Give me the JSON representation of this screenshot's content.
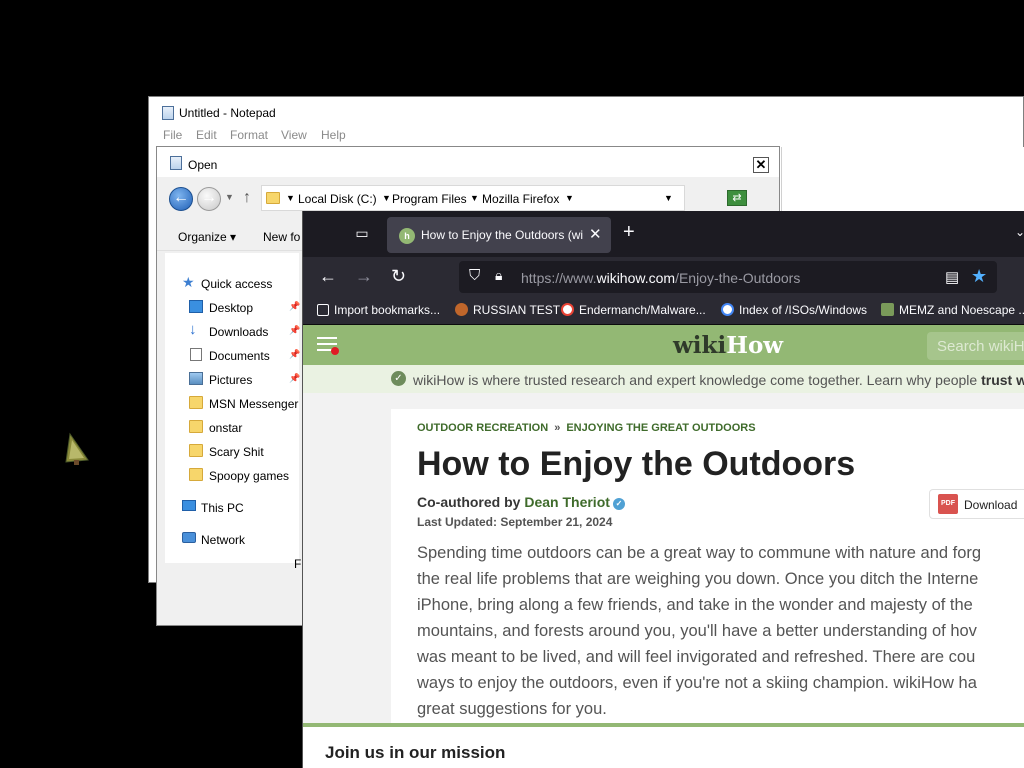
{
  "notepad": {
    "title": "Untitled - Notepad",
    "menu": [
      "File",
      "Edit",
      "Format",
      "View",
      "Help"
    ]
  },
  "open_dialog": {
    "title": "Open",
    "breadcrumb": [
      "Local Disk (C:)",
      "Program Files",
      "Mozilla Firefox"
    ],
    "toolbar": {
      "organize": "Organize",
      "new_folder": "New fo"
    },
    "nav_items": [
      {
        "label": "Quick access",
        "icon": "star-icon"
      },
      {
        "label": "Desktop",
        "icon": "desktop-icon"
      },
      {
        "label": "Downloads",
        "icon": "download-arrow-icon"
      },
      {
        "label": "Documents",
        "icon": "document-icon"
      },
      {
        "label": "Pictures",
        "icon": "picture-icon"
      },
      {
        "label": "MSN Messenger",
        "icon": "folder-icon"
      },
      {
        "label": "onstar",
        "icon": "folder-icon"
      },
      {
        "label": "Scary Shit",
        "icon": "folder-icon"
      },
      {
        "label": "Spoopy games",
        "icon": "folder-icon"
      },
      {
        "label": "This PC",
        "icon": "computer-icon"
      },
      {
        "label": "Network",
        "icon": "network-icon"
      }
    ],
    "partial_text": "F"
  },
  "firefox": {
    "tab_title": "How to Enjoy the Outdoors (wikiHow)",
    "url_prefix": "https://www.",
    "url_host": "wikihow.com",
    "url_path": "/Enjoy-the-Outdoors",
    "bookmarks": [
      {
        "label": "Import bookmarks...",
        "icon": "import-icon"
      },
      {
        "label": "RUSSIAN TEST",
        "icon": "site-favicon"
      },
      {
        "label": "Endermanch/Malware...",
        "icon": "google-icon"
      },
      {
        "label": "Index of /ISOs/Windows",
        "icon": "google-icon"
      },
      {
        "label": "MEMZ and Noescape ...",
        "icon": "site-favicon"
      }
    ]
  },
  "wikihow": {
    "logo_wiki": "wiki",
    "logo_how": "How",
    "search_placeholder": "Search wikiH",
    "trust_text": "wikiHow is where trusted research and expert knowledge come together. Learn why people ",
    "trust_bold": "trust w",
    "breadcrumb_1": "OUTDOOR RECREATION",
    "breadcrumb_sep": "»",
    "breadcrumb_2": "ENJOYING THE GREAT OUTDOORS",
    "title": "How to Enjoy the Outdoors",
    "coauthored_by": "Co-authored by ",
    "author": "Dean Theriot",
    "last_updated": "Last Updated: September 21, 2024",
    "download_label": "Download",
    "intro_lines": [
      "Spending time outdoors can be a great way to commune with nature and forg",
      "the real life problems that are weighing you down. Once you ditch the Interne",
      "iPhone, bring along a few friends, and take in the wonder and majesty of the",
      "mountains, and forests around you, you'll have a better understanding of hov",
      "was meant to be lived, and will feel invigorated and refreshed. There are cou",
      "ways to enjoy the outdoors, even if you're not a skiing champion. wikiHow ha",
      "great suggestions for you."
    ],
    "mission": "Join us in our mission"
  },
  "colors": {
    "wikihow_green": "#93b874",
    "firefox_dark": "#2b2a33",
    "firefox_tabstrip": "#1c1b22",
    "star_blue": "#53b1ff"
  }
}
